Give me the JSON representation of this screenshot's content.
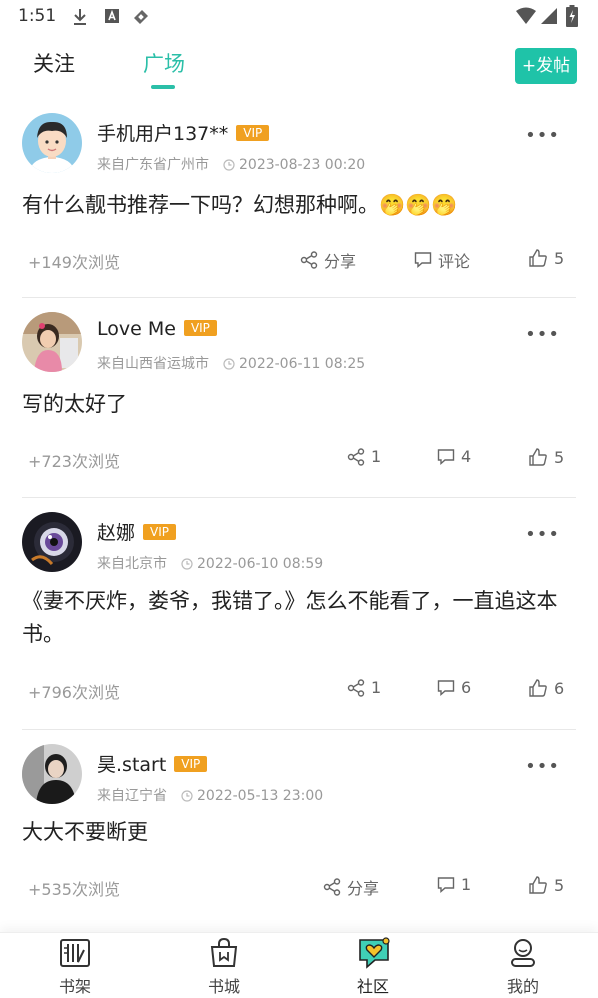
{
  "status_bar": {
    "time": "1:51",
    "icons": [
      "download-icon",
      "a-box-icon",
      "tag-icon",
      "wifi-icon",
      "signal-icon",
      "battery-icon"
    ]
  },
  "header": {
    "tabs": [
      {
        "label": "关注",
        "active": false
      },
      {
        "label": "广场",
        "active": true
      }
    ],
    "post_button": "+发帖"
  },
  "posts": [
    {
      "username": "手机用户137**",
      "vip": "VIP",
      "location": "来自广东省广州市",
      "time": "2023-08-23 00:20",
      "content": "有什么靓书推荐一下吗？幻想那种啊。",
      "emojis": "🤭🤭🤭",
      "views": "+149次浏览",
      "share": "分享",
      "comment": "评论",
      "likes": "5"
    },
    {
      "username": "Love Me",
      "vip": "VIP",
      "location": "来自山西省运城市",
      "time": "2022-06-11 08:25",
      "content": "写的太好了",
      "views": "+723次浏览",
      "share": "1",
      "comment": "4",
      "likes": "5"
    },
    {
      "username": "赵娜",
      "vip": "VIP",
      "location": "来自北京市",
      "time": "2022-06-10 08:59",
      "content": "《妻不厌炸，娄爷，我错了。》怎么不能看了，一直追这本书。",
      "views": "+796次浏览",
      "share": "1",
      "comment": "6",
      "likes": "6"
    },
    {
      "username": "昊.start",
      "vip": "VIP",
      "location": "来自辽宁省",
      "time": "2022-05-13 23:00",
      "content": "大大不要断更",
      "views": "+535次浏览",
      "share": "分享",
      "comment": "1",
      "likes": "5"
    }
  ],
  "bottom_nav": [
    {
      "label": "书架",
      "icon": "bookshelf-icon",
      "active": false
    },
    {
      "label": "书城",
      "icon": "bookstore-bag-icon",
      "active": false
    },
    {
      "label": "社区",
      "icon": "community-heart-icon",
      "active": true
    },
    {
      "label": "我的",
      "icon": "profile-icon",
      "active": false
    }
  ],
  "colors": {
    "accent": "#2bbfa8",
    "post_button": "#1fc3a8",
    "vip": "#f0a020",
    "muted_text": "#999999"
  }
}
